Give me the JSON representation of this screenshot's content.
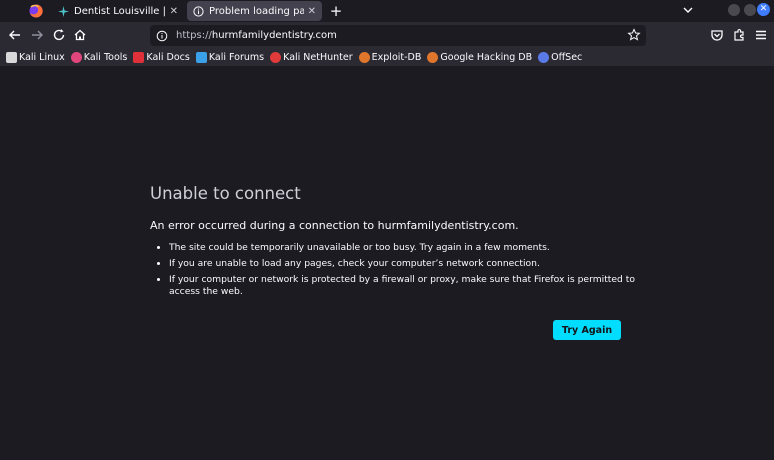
{
  "tabs": [
    {
      "title": "Dentist Louisville | Hurm",
      "active": false,
      "icon": "site-favicon-icon"
    },
    {
      "title": "Problem loading page",
      "active": true,
      "icon": "info-icon"
    }
  ],
  "url": {
    "scheme": "https://",
    "host": "hurmfamilydentistry.com"
  },
  "bookmarks": [
    {
      "label": "Kali Linux",
      "icon": "kali-icon",
      "color": "#d8d8d8"
    },
    {
      "label": "Kali Tools",
      "icon": "kali-tools-icon",
      "color": "#e0467c"
    },
    {
      "label": "Kali Docs",
      "icon": "kali-docs-icon",
      "color": "#e0303a"
    },
    {
      "label": "Kali Forums",
      "icon": "kali-forums-icon",
      "color": "#3aa0e8"
    },
    {
      "label": "Kali NetHunter",
      "icon": "nethunter-icon",
      "color": "#e03a3a"
    },
    {
      "label": "Exploit-DB",
      "icon": "exploit-db-icon",
      "color": "#e0762c"
    },
    {
      "label": "Google Hacking DB",
      "icon": "ghdb-icon",
      "color": "#e0762c"
    },
    {
      "label": "OffSec",
      "icon": "offsec-icon",
      "color": "#5a7ae8"
    }
  ],
  "error": {
    "title": "Unable to connect",
    "description": "An error occurred during a connection to hurmfamilydentistry.com.",
    "items": [
      "The site could be temporarily unavailable or too busy. Try again in a few moments.",
      "If you are unable to load any pages, check your computer’s network connection.",
      "If your computer or network is protected by a firewall or proxy, make sure that Firefox is permitted to access the web."
    ],
    "button": "Try Again"
  },
  "colors": {
    "background": "#1c1b22",
    "toolbar": "#2b2a33",
    "accent_button": "#00ddff",
    "window_close": "#3f7cff"
  }
}
